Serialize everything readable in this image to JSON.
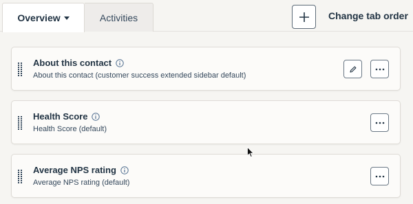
{
  "tabs": {
    "overview_label": "Overview",
    "activities_label": "Activities",
    "change_order_label": "Change tab order"
  },
  "cards": [
    {
      "title": "About this contact",
      "subtitle": "About this contact (customer success extended sidebar default)",
      "has_edit": true
    },
    {
      "title": "Health Score",
      "subtitle": "Health Score (default)",
      "has_edit": false
    },
    {
      "title": "Average NPS rating",
      "subtitle": "Average NPS rating (default)",
      "has_edit": false
    }
  ],
  "icons": {
    "add": "plus-icon",
    "edit": "pencil-icon",
    "more": "ellipsis-icon",
    "info": "info-icon",
    "drag": "drag-handle-icon"
  },
  "colors": {
    "background": "#f6f5f2",
    "card": "#fcfbf9",
    "text": "#213343",
    "border": "#dedbd6"
  }
}
